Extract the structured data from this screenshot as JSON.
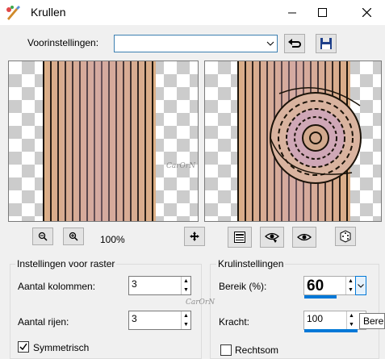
{
  "window": {
    "title": "Krullen"
  },
  "presets": {
    "label": "Voorinstellingen:",
    "value": ""
  },
  "zoom": {
    "value": "100%"
  },
  "raster": {
    "title": "Instellingen voor raster",
    "columns_label": "Aantal kolommen:",
    "columns_value": "3",
    "rows_label": "Aantal rijen:",
    "rows_value": "3",
    "symmetric_label": "Symmetrisch",
    "symmetric_checked": true
  },
  "curl": {
    "title": "Krulinstellingen",
    "range_label": "Bereik (%):",
    "range_value": "60",
    "range_fraction": 0.6,
    "strength_label": "Kracht:",
    "strength_value": "100",
    "strength_fraction": 1.0,
    "clockwise_label": "Rechtsom",
    "clockwise_checked": false
  },
  "tooltip": {
    "text": "Bere"
  },
  "watermark": {
    "text": "CarOrN"
  }
}
